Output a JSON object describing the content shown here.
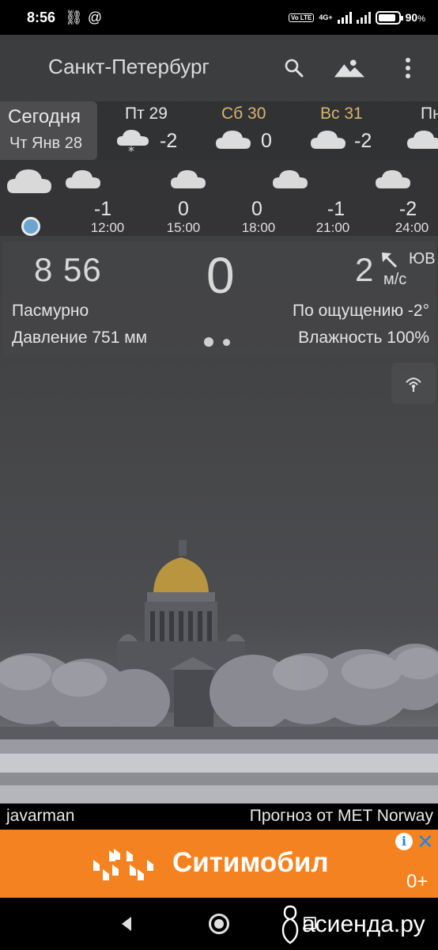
{
  "status_bar": {
    "time": "8:56",
    "network": "4G+",
    "volte": "Vo LTE",
    "battery_percent": "90",
    "battery_level": 0.9
  },
  "app_bar": {
    "city": "Санкт-Петербург",
    "icons": [
      "search-icon",
      "landscape-icon",
      "more-vert-icon"
    ]
  },
  "today": {
    "label": "Сегодня",
    "date": "Чт Янв 28"
  },
  "days": [
    {
      "name": "Пт 29",
      "temp": "-2",
      "icon": "cloud-snow-icon",
      "weekend": false
    },
    {
      "name": "Сб 30",
      "temp": "0",
      "icon": "cloud-icon",
      "weekend": true
    },
    {
      "name": "Вс 31",
      "temp": "-2",
      "icon": "cloud-icon",
      "weekend": true
    },
    {
      "name": "Пн",
      "temp": "",
      "icon": "cloud-icon",
      "weekend": false
    }
  ],
  "hours": [
    {
      "temp": "-1",
      "time": "12:00"
    },
    {
      "temp": "0",
      "time": "15:00"
    },
    {
      "temp": "0",
      "time": "18:00"
    },
    {
      "temp": "-1",
      "time": "21:00"
    },
    {
      "temp": "-2",
      "time": "24:00"
    }
  ],
  "current": {
    "time": "8 56",
    "temp": "0",
    "wind_speed": "2",
    "wind_dir": "ЮВ",
    "wind_unit": "м/с",
    "condition": "Пасмурно",
    "feels_like": "По ощущению -2°",
    "pressure": "Давление 751 мм",
    "humidity": "Влажность 100%"
  },
  "footer": {
    "author": "javarman",
    "provider": "Прогноз от MET Norway"
  },
  "ad": {
    "brand": "Ситимобил",
    "age": "0+"
  },
  "watermark": "асиенда.ру",
  "colors": {
    "weekend": "#d7b570",
    "ad_bg": "#f58220",
    "now_dot": "#6aa5cf"
  }
}
